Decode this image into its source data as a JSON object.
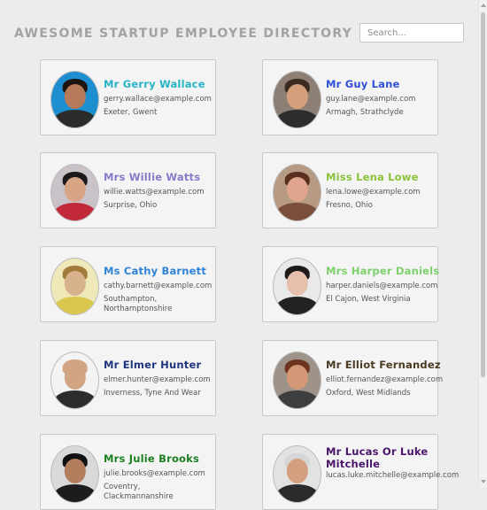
{
  "header": {
    "title": "Awesome Startup Employee Directory",
    "search_placeholder": "Search..."
  },
  "employees": [
    {
      "name": "Mr Gerry Wallace",
      "email": "gerry.wallace@example.com",
      "location": "Exeter, Gwent",
      "name_color": "#27b3c7",
      "skin": "#b77a58",
      "hair": "#1d140f",
      "shirt": "#2b2b2b",
      "bg": "#1d8fd1"
    },
    {
      "name": "Mr Guy Lane",
      "email": "guy.lane@example.com",
      "location": "Armagh, Strathclyde",
      "name_color": "#2f4fd8",
      "skin": "#d3a07b",
      "hair": "#3b2a1f",
      "shirt": "#2d2d2d",
      "bg": "#8d7f73"
    },
    {
      "name": "Mrs Willie Watts",
      "email": "willie.watts@example.com",
      "location": "Surprise, Ohio",
      "name_color": "#8b78c9",
      "skin": "#d7a486",
      "hair": "#1a1a1a",
      "shirt": "#c1283a",
      "bg": "#c9c2c8"
    },
    {
      "name": "Miss Lena Lowe",
      "email": "lena.lowe@example.com",
      "location": "Fresno, Ohio",
      "name_color": "#8bc23c",
      "skin": "#dfa48d",
      "hair": "#5a2f1f",
      "shirt": "#7a4e3a",
      "bg": "#b79a84"
    },
    {
      "name": "Ms Cathy Barnett",
      "email": "cathy.barnett@example.com",
      "location": "Southampton, Northamptonshire",
      "name_color": "#2f84d8",
      "skin": "#d8b18d",
      "hair": "#a27a3c",
      "shirt": "#d9c84d",
      "bg": "#efe8b8"
    },
    {
      "name": "Mrs Harper Daniels",
      "email": "harper.daniels@example.com",
      "location": "El Cajon, West Virginia",
      "name_color": "#7ed06d",
      "skin": "#e6c0ac",
      "hair": "#1e1a1a",
      "shirt": "#222222",
      "bg": "#e9e9e9"
    },
    {
      "name": "Mr Elmer Hunter",
      "email": "elmer.hunter@example.com",
      "location": "Inverness, Tyne And Wear",
      "name_color": "#1f347d",
      "skin": "#d1a484",
      "hair": "#d1a484",
      "shirt": "#2c2c2c",
      "bg": "#f3f3f3"
    },
    {
      "name": "Mr Elliot Fernandez",
      "email": "elliot.fernandez@example.com",
      "location": "Oxford, West Midlands",
      "name_color": "#4b3a22",
      "skin": "#d49877",
      "hair": "#6d3420",
      "shirt": "#3e3e3e",
      "bg": "#9d9389"
    },
    {
      "name": "Mrs Julie Brooks",
      "email": "julie.brooks@example.com",
      "location": "Coventry, Clackmannanshire",
      "name_color": "#1b7f1f",
      "skin": "#b37e5d",
      "hair": "#101010",
      "shirt": "#1c1c1c",
      "bg": "#d9d9d9"
    },
    {
      "name": "Mr Lucas Or Luke Mitchelle",
      "email": "lucas.luke.mitchelle@example.com",
      "location": "",
      "name_color": "#4a1569",
      "skin": "#d2a07e",
      "hair": "#d6d6d6",
      "shirt": "#2a2a2a",
      "bg": "#e2e2e2"
    }
  ]
}
